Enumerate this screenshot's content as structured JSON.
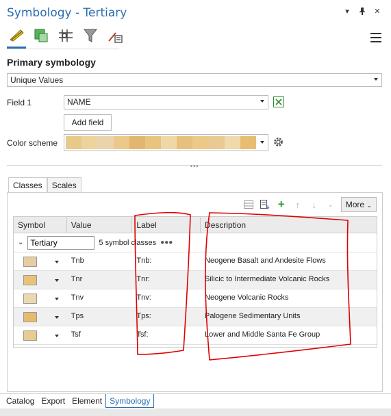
{
  "window": {
    "title": "Symbology - Tertiary",
    "controls": [
      "▾",
      "⊿",
      "✕"
    ]
  },
  "toolbar": {
    "items": [
      "primary-symbology",
      "vary-symbology",
      "symbol-layer-drawing",
      "label-classes",
      "symbology-options"
    ]
  },
  "primary": {
    "heading": "Primary symbology",
    "renderer": "Unique Values",
    "field1_label": "Field 1",
    "field1_value": "NAME",
    "add_field": "Add field",
    "color_scheme_label": "Color scheme",
    "ramp_colors": [
      "#e8c98a",
      "#efd39d",
      "#e9d4ab",
      "#ecc98a",
      "#e2b670",
      "#e8c47f",
      "#f0d8a6",
      "#e6c07c",
      "#edc987",
      "#e9ca92",
      "#f0d9aa",
      "#e6bd72"
    ]
  },
  "tabs": [
    "Classes",
    "Scales"
  ],
  "grid_toolbar": {
    "more": "More"
  },
  "grid": {
    "headers": [
      "Symbol",
      "Value",
      "Label",
      "Description"
    ],
    "group_name": "Tertiary",
    "group_count": "5 symbol classes",
    "group_more": "●●●",
    "rows": [
      {
        "color": "#e7cda0",
        "value": "Tnb",
        "label": "Tnb:",
        "description": "Neogene Basalt and Andesite Flows"
      },
      {
        "color": "#e9c27a",
        "value": "Tnr",
        "label": "Tnr:",
        "description": "Silicic to Intermediate Volcanic Rocks"
      },
      {
        "color": "#ecd8af",
        "value": "Tnv",
        "label": "Tnv:",
        "description": "Neogene Volcanic Rocks"
      },
      {
        "color": "#e7bb6c",
        "value": "Tps",
        "label": "Tps:",
        "description": "Palogene Sedimentary Units"
      },
      {
        "color": "#e8cb90",
        "value": "Tsf",
        "label": "Tsf:",
        "description": "Lower and Middle Santa Fe Group"
      }
    ]
  },
  "bottom_tabs": [
    "Catalog",
    "Export",
    "Element",
    "Symbology"
  ],
  "accent": "#2a6db0",
  "annotation_color": "#e00000"
}
